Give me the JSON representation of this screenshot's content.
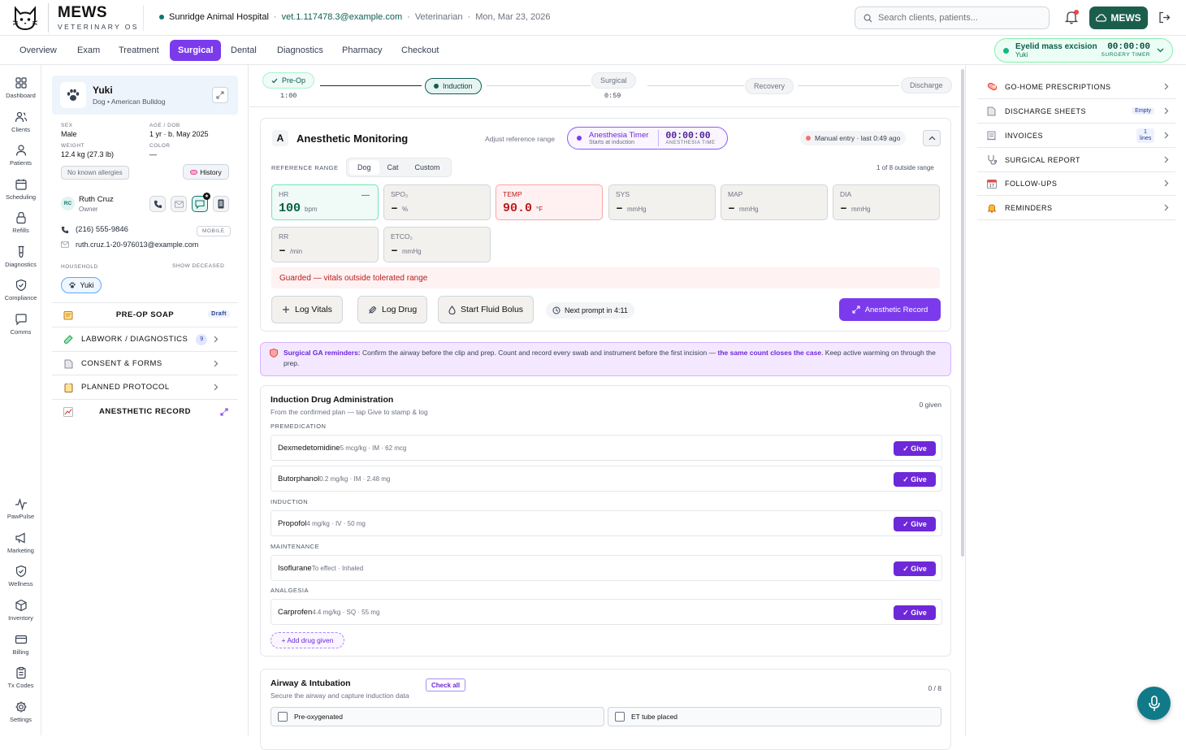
{
  "app": {
    "name": "MEWS",
    "subtitle": "VETERINARY OS"
  },
  "header": {
    "hospital": "Sunridge Animal Hospital",
    "user_email": "vet.1.117478.3@example.com",
    "role": "Veterinarian",
    "date": "Mon, Mar 23, 2026",
    "search_placeholder": "Search clients, patients...",
    "mews_button": "MEWS",
    "colors": {
      "brand": "#1b5e4c",
      "accent": "#7c3aed",
      "alert": "#b91c1c"
    }
  },
  "tabs": [
    {
      "label": "Overview"
    },
    {
      "label": "Exam"
    },
    {
      "label": "Treatment"
    },
    {
      "label": "Surgical",
      "active": true
    },
    {
      "label": "Dental"
    },
    {
      "label": "Diagnostics"
    },
    {
      "label": "Pharmacy"
    },
    {
      "label": "Checkout"
    }
  ],
  "surgery_timer": {
    "procedure": "Eyelid mass excision",
    "patient": "Yuki",
    "time": "00:00:00",
    "label": "SURGERY TIMER"
  },
  "nav": [
    {
      "label": "Dashboard",
      "icon": "dashboard-icon"
    },
    {
      "label": "Clients",
      "icon": "clients-icon"
    },
    {
      "label": "Patients",
      "icon": "patients-icon"
    },
    {
      "label": "Scheduling",
      "icon": "calendar-icon"
    },
    {
      "label": "Refills",
      "icon": "lock-icon"
    },
    {
      "label": "Diagnostics",
      "icon": "flask-icon"
    },
    {
      "label": "Compliance",
      "icon": "shield-icon"
    },
    {
      "label": "Comms",
      "icon": "chat-icon"
    }
  ],
  "nav_bottom": [
    {
      "label": "PawPulse",
      "icon": "pulse-icon"
    },
    {
      "label": "Marketing",
      "icon": "megaphone-icon"
    },
    {
      "label": "Wellness",
      "icon": "shield-check-icon"
    },
    {
      "label": "Inventory",
      "icon": "box-icon"
    },
    {
      "label": "Billing",
      "icon": "card-icon"
    },
    {
      "label": "Tx Codes",
      "icon": "clipboard-icon"
    },
    {
      "label": "Settings",
      "icon": "gear-icon"
    }
  ],
  "patient": {
    "name": "Yuki",
    "breed": "Dog • American Bulldog",
    "sex_label": "SEX",
    "sex": "Male",
    "age_label": "AGE / DOB",
    "age": "1 yr · b. May 2025",
    "weight_label": "WEIGHT",
    "weight": "12.4 kg (27.3 lb)",
    "color_label": "COLOR",
    "color": "—",
    "allergies": "No known allergies",
    "history_button": "History"
  },
  "owner": {
    "initials": "RC",
    "name": "Ruth Cruz",
    "role": "Owner",
    "phone": "(216) 555-9846",
    "phone_tag": "MOBILE",
    "email": "ruth.cruz.1-20-976013@example.com"
  },
  "household": {
    "label": "HOUSEHOLD",
    "show_deceased": "SHOW DECEASED",
    "members": [
      "Yuki"
    ]
  },
  "sections": [
    {
      "label": "PRE-OP SOAP",
      "badge": "Draft"
    },
    {
      "label": "LABWORK / DIAGNOSTICS",
      "count": "9"
    },
    {
      "label": "CONSENT & FORMS"
    },
    {
      "label": "PLANNED PROTOCOL"
    },
    {
      "label": "ANESTHETIC RECORD"
    }
  ],
  "stepper": [
    {
      "label": "Pre-Op",
      "time": "1:00",
      "state": "done"
    },
    {
      "label": "Induction",
      "time": "",
      "state": "current"
    },
    {
      "label": "Surgical",
      "time": "0:59",
      "state": "pending"
    },
    {
      "label": "Recovery",
      "time": "",
      "state": "pending"
    },
    {
      "label": "Discharge",
      "time": "",
      "state": "pending"
    }
  ],
  "anesthetic": {
    "letter": "A",
    "title": "Anesthetic Monitoring",
    "adjust": "Adjust reference range",
    "timer_title": "Anesthesia Timer",
    "timer_sub": "Starts at induction",
    "timer_value": "00:00:00",
    "timer_label": "ANESTHESIA TIME",
    "manual": "Manual entry · last 0:49 ago",
    "ref_label": "REFERENCE RANGE",
    "ref_options": [
      "Dog",
      "Cat",
      "Custom"
    ],
    "outside": "1 of 8 outside range",
    "vitals": [
      {
        "label": "HR",
        "value": "100",
        "unit": "bpm",
        "state": "ok"
      },
      {
        "label": "SPO₂",
        "value": "–",
        "unit": "%",
        "state": "empty"
      },
      {
        "label": "TEMP",
        "value": "90.0",
        "unit": "°F",
        "state": "alert"
      },
      {
        "label": "SYS",
        "value": "–",
        "unit": "mmHg",
        "state": "empty"
      },
      {
        "label": "MAP",
        "value": "–",
        "unit": "mmHg",
        "state": "empty"
      },
      {
        "label": "DIA",
        "value": "–",
        "unit": "mmHg",
        "state": "empty"
      },
      {
        "label": "RR",
        "value": "–",
        "unit": "/min",
        "state": "empty"
      },
      {
        "label": "ETCO₂",
        "value": "–",
        "unit": "mmHg",
        "state": "empty"
      }
    ],
    "guard": "Guarded — vitals outside tolerated range",
    "log_vitals": "Log Vitals",
    "log_drug": "Log Drug",
    "fluid": "Start Fluid Bolus",
    "next_prompt": "Next prompt in 4:11",
    "record_button": "Anesthetic Record"
  },
  "reminder": {
    "title": "Surgical GA reminders:",
    "text1": " Confirm the airway before the clip and prep. Count and record every swab and instrument before the first incision — ",
    "highlight": "the same count closes the case",
    "text2": ". Keep active warming on through the prep."
  },
  "induction": {
    "title": "Induction Drug Administration",
    "subtitle": "From the confirmed plan — tap Give to stamp & log",
    "count": "0 given",
    "give": "✓ Give",
    "add": "+ Add drug given",
    "groups": [
      {
        "label": "PREMEDICATION",
        "drugs": [
          {
            "name": "Dexmedetomidine",
            "dose": "5 mcg/kg · IM · 62 mcg"
          },
          {
            "name": "Butorphanol",
            "dose": "0.2 mg/kg · IM · 2.48 mg"
          }
        ]
      },
      {
        "label": "INDUCTION",
        "drugs": [
          {
            "name": "Propofol",
            "dose": "4 mg/kg · IV · 50 mg"
          }
        ]
      },
      {
        "label": "MAINTENANCE",
        "drugs": [
          {
            "name": "Isoflurane",
            "dose": "To effect · Inhaled"
          }
        ]
      },
      {
        "label": "ANALGESIA",
        "drugs": [
          {
            "name": "Carprofen",
            "dose": "4.4 mg/kg · SQ · 55 mg"
          }
        ]
      }
    ]
  },
  "airway": {
    "title": "Airway & Intubation",
    "subtitle": "Secure the airway and capture induction data",
    "check_all": "Check all",
    "count": "0 / 8",
    "items": [
      "Pre-oxygenated",
      "ET tube placed"
    ]
  },
  "right_panel": [
    {
      "label": "GO-HOME PRESCRIPTIONS",
      "icon": "pill-icon"
    },
    {
      "label": "DISCHARGE SHEETS",
      "icon": "document-icon",
      "badge": "Empty"
    },
    {
      "label": "INVOICES",
      "icon": "receipt-icon",
      "badge": "1 lines"
    },
    {
      "label": "SURGICAL REPORT",
      "icon": "stethoscope-icon"
    },
    {
      "label": "FOLLOW-UPS",
      "icon": "calendar-icon"
    },
    {
      "label": "REMINDERS",
      "icon": "bell-icon"
    }
  ]
}
